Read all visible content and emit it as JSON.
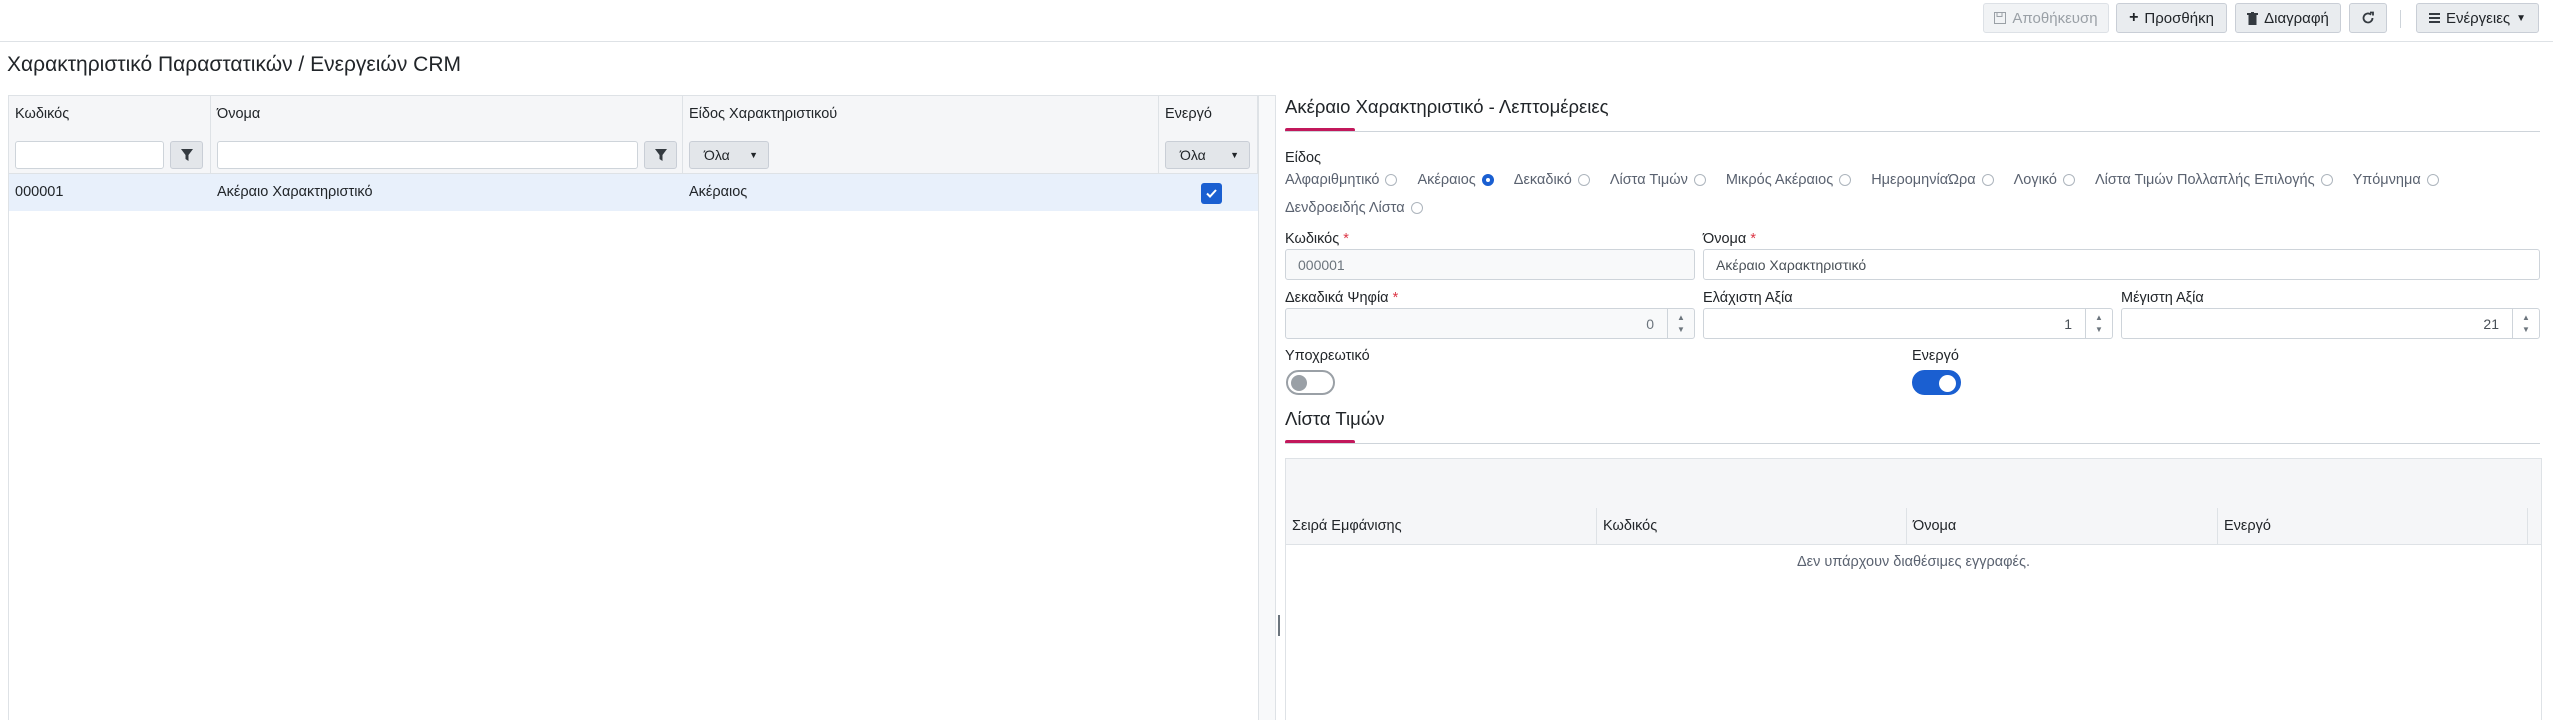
{
  "toolbar": {
    "save_label": "Αποθήκευση",
    "add_label": "Προσθήκη",
    "delete_label": "Διαγραφή",
    "actions_label": "Ενέργειες"
  },
  "page_title": "Χαρακτηριστικό Παραστατικών / Ενεργειών CRM",
  "grid": {
    "columns": [
      "Κωδικός",
      "Όνομα",
      "Είδος Χαρακτηριστικού",
      "Ενεργό"
    ],
    "filter_kind_value": "Όλα",
    "filter_active_value": "Όλα",
    "rows": [
      {
        "code": "000001",
        "name": "Ακέραιο Χαρακτηριστικό",
        "kind": "Ακέραιος",
        "active": true
      }
    ]
  },
  "details": {
    "title": "Ακέραιο Χαρακτηριστικό - Λεπτομέρειες",
    "kind_label": "Είδος",
    "kind_options": [
      "Αλφαριθμητικό",
      "Ακέραιος",
      "Δεκαδικό",
      "Λίστα Τιμών",
      "Μικρός Ακέραιος",
      "ΗμερομηνίαΏρα",
      "Λογικό",
      "Λίστα Τιμών Πολλαπλής Επιλογής",
      "Υπόμνημα",
      "Δενδροειδής Λίστα"
    ],
    "kind_selected": "Ακέραιος",
    "code_label": "Κωδικός",
    "code_value": "000001",
    "name_label": "Όνομα",
    "name_value": "Ακέραιο Χαρακτηριστικό",
    "decimals_label": "Δεκαδικά Ψηφία",
    "decimals_value": "0",
    "min_label": "Ελάχιστη Αξία",
    "min_value": "1",
    "max_label": "Μέγιστη Αξία",
    "max_value": "21",
    "required_label": "Υποχρεωτικό",
    "required_on": false,
    "active_label": "Ενεργό",
    "active_on": true,
    "required_marker": "*"
  },
  "values_list": {
    "title": "Λίστα Τιμών",
    "columns": [
      "Σειρά Εμφάνισης",
      "Κωδικός",
      "Όνομα",
      "Ενεργό"
    ],
    "empty_text": "Δεν υπάρχουν διαθέσιμες εγγραφές."
  },
  "icons": {
    "save": "floppy-icon",
    "add": "plus-icon",
    "delete": "trash-icon",
    "refresh": "refresh-icon",
    "actions": "hamburger-icon",
    "filter": "funnel-icon"
  },
  "colors": {
    "accent": "#c2185b",
    "primary": "#1a5fd1",
    "row_selected": "#e8f0fb"
  }
}
